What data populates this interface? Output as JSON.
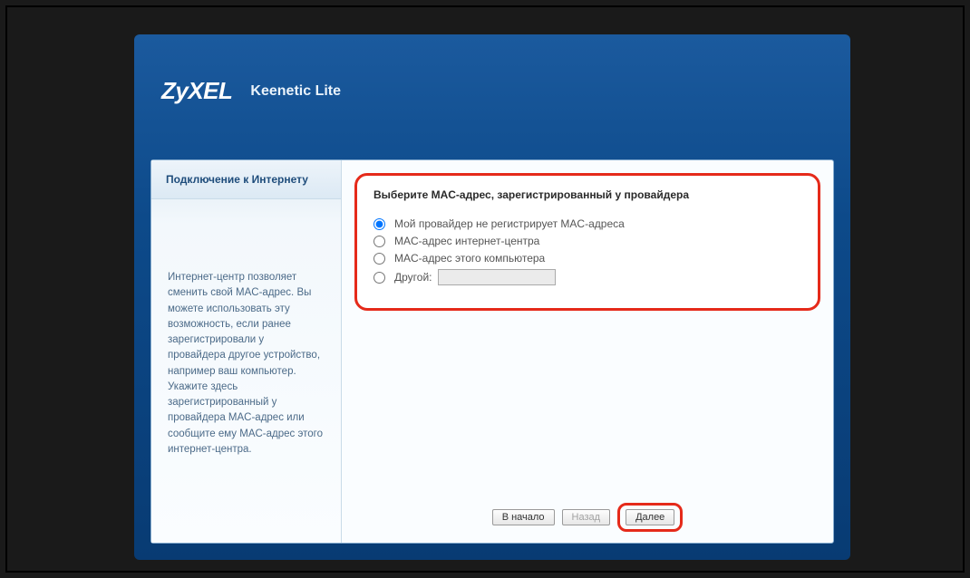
{
  "header": {
    "logo": "ZyXEL",
    "product": "Keenetic Lite"
  },
  "sidebar": {
    "tab_label": "Подключение к Интернету",
    "help": "Интернет-центр позволяет сменить свой MAC-адрес. Вы можете использовать эту возможность, если ранее зарегистрировали у провайдера другое устройство, например ваш компьютер. Укажите здесь зарегистрированный у провайдера MAC-адрес или сообщите ему MAC-адрес этого интернет-центра."
  },
  "form": {
    "title": "Выберите MAC-адрес, зарегистрированный у провайдера",
    "options": {
      "no_register": "Мой провайдер не регистрирует MAC-адреса",
      "router_mac": "MAC-адрес интернет-центра",
      "pc_mac": "MAC-адрес этого компьютера",
      "other": "Другой:"
    },
    "other_value": ""
  },
  "buttons": {
    "start": "В начало",
    "back": "Назад",
    "next": "Далее"
  }
}
